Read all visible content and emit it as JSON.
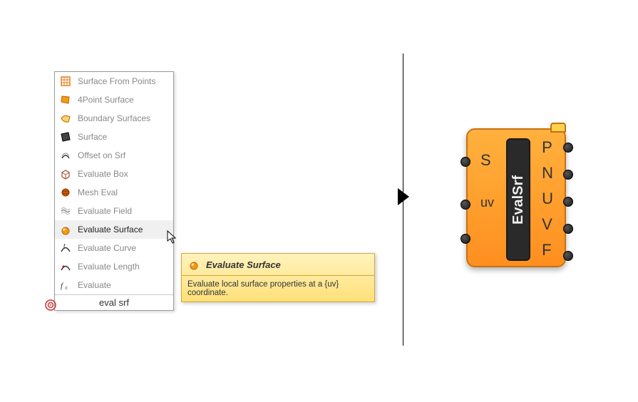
{
  "menu": {
    "items": [
      {
        "label": "Surface From Points",
        "icon": "grid-orange"
      },
      {
        "label": "4Point Surface",
        "icon": "quad-orange"
      },
      {
        "label": "Boundary Surfaces",
        "icon": "boundary"
      },
      {
        "label": "Surface",
        "icon": "surface-dark"
      },
      {
        "label": "Offset on Srf",
        "icon": "offset"
      },
      {
        "label": "Evaluate Box",
        "icon": "box"
      },
      {
        "label": "Mesh Eval",
        "icon": "sphere"
      },
      {
        "label": "Evaluate Field",
        "icon": "field"
      },
      {
        "label": "Evaluate Surface",
        "icon": "srf-eval",
        "selected": true
      },
      {
        "label": "Evaluate Curve",
        "icon": "curve"
      },
      {
        "label": "Evaluate Length",
        "icon": "length"
      },
      {
        "label": "Evaluate",
        "icon": "fx"
      }
    ],
    "search_value": "eval srf"
  },
  "tooltip": {
    "title": "Evaluate Surface",
    "description": "Evaluate local surface properties at a {uv} coordinate."
  },
  "component": {
    "name": "EvalSrf",
    "inputs": [
      "S",
      "uv"
    ],
    "outputs": [
      "P",
      "N",
      "U",
      "V",
      "F"
    ]
  }
}
